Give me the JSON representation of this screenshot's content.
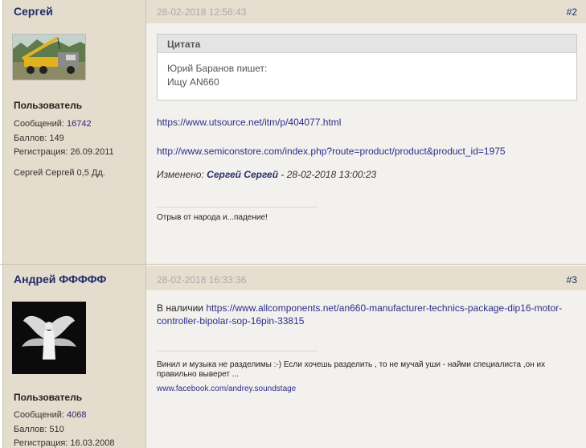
{
  "posts": [
    {
      "author": "Сергей",
      "rank": "Пользователь",
      "messages_label": "Сообщений:",
      "messages_value": "16742",
      "points_label": "Баллов:",
      "points_value": "149",
      "registration_label": "Регистрация:",
      "registration_value": "26.09.2011",
      "user_signature_name": "Сергей Сергей 0,5 Дд.",
      "date": "28-02-2018 12:56:43",
      "number": "#2",
      "quote": {
        "title": "Цитата",
        "author_line": "Юрий Баранов пишет:",
        "text": "Ищу AN660"
      },
      "link_1": "https://www.utsource.net/itm/p/404077.html",
      "link_2": "http://www.semiconstore.com/index.php?route=product/product&product_id=1975",
      "edited_label": "Изменено:",
      "edited_by": "Сергей Сергей",
      "edited_date": "- 28-02-2018 13:00:23",
      "signature": "Отрыв от народа и...падение!"
    },
    {
      "author": "Андрей ФФФФФ",
      "rank": "Пользователь",
      "messages_label": "Сообщений:",
      "messages_value": "4068",
      "points_label": "Баллов:",
      "points_value": "510",
      "registration_label": "Регистрация:",
      "registration_value": "16.03.2008",
      "date": "28-02-2018 16:33:36",
      "number": "#3",
      "body_prefix": "В наличии",
      "body_link": "https://www.allcomponents.net/an660-manufacturer-technics-package-dip16-motor-controller-bipolar-sop-16pin-33815",
      "signature": "Винил и музыка не разделимы  :-) Если хочешь разделить , то не мучай уши - найми специалиста ,он их правильно выверет ...",
      "signature_link": "www.facebook.com/andrey.soundstage"
    }
  ]
}
